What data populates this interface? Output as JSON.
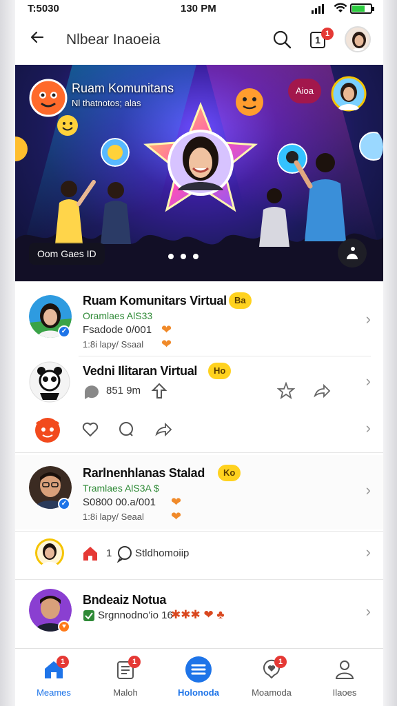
{
  "status_bar": {
    "left_time": "T:5030",
    "center_time": "130 PM"
  },
  "header": {
    "title": "Nlbear Inaoeia",
    "notif_count": "1",
    "notif_glyph": "1"
  },
  "hero": {
    "title": "Ruam Komunitans",
    "subtitle": "Nl thatnotos; alas",
    "pill": "Aioa",
    "chip": "Oom Gaes ID"
  },
  "feed": [
    {
      "name": "Ruam Komunitars Virtual",
      "tag": "Ba",
      "green": "Oramlaes AlS33",
      "meta": "Fsadode 0/001",
      "meta2": "1:8i lapy/ Ssaal"
    },
    {
      "name": "Vedni Ilitaran Virtual",
      "tag": "Ho",
      "meta": "851 9m"
    },
    {
      "name": "Rarlnenhlanas Stalad",
      "tag": "Ko",
      "green": "Tramlaes AlS3A $",
      "meta": "S0800 00.a/001",
      "meta2": "1:8i lapy/ Seaal"
    },
    {
      "label_prefix": "1",
      "label": "Stldhomoiip"
    },
    {
      "name": "Bndeaiz Notua",
      "meta": "Srgnnodno'io 16"
    }
  ],
  "bottom_nav": [
    {
      "label": "Meames",
      "badge": "1",
      "active": true
    },
    {
      "label": "Maloh",
      "badge": "1",
      "active": false
    },
    {
      "label": "Holonoda",
      "badge": "",
      "active": false
    },
    {
      "label": "Moamoda",
      "badge": "1",
      "active": false
    },
    {
      "label": "Ilaoes",
      "badge": "",
      "active": false
    }
  ],
  "colors": {
    "accent": "#1e74e8",
    "badge": "#e53935",
    "tag": "#ffd21f",
    "green_text": "#2f8a37"
  }
}
